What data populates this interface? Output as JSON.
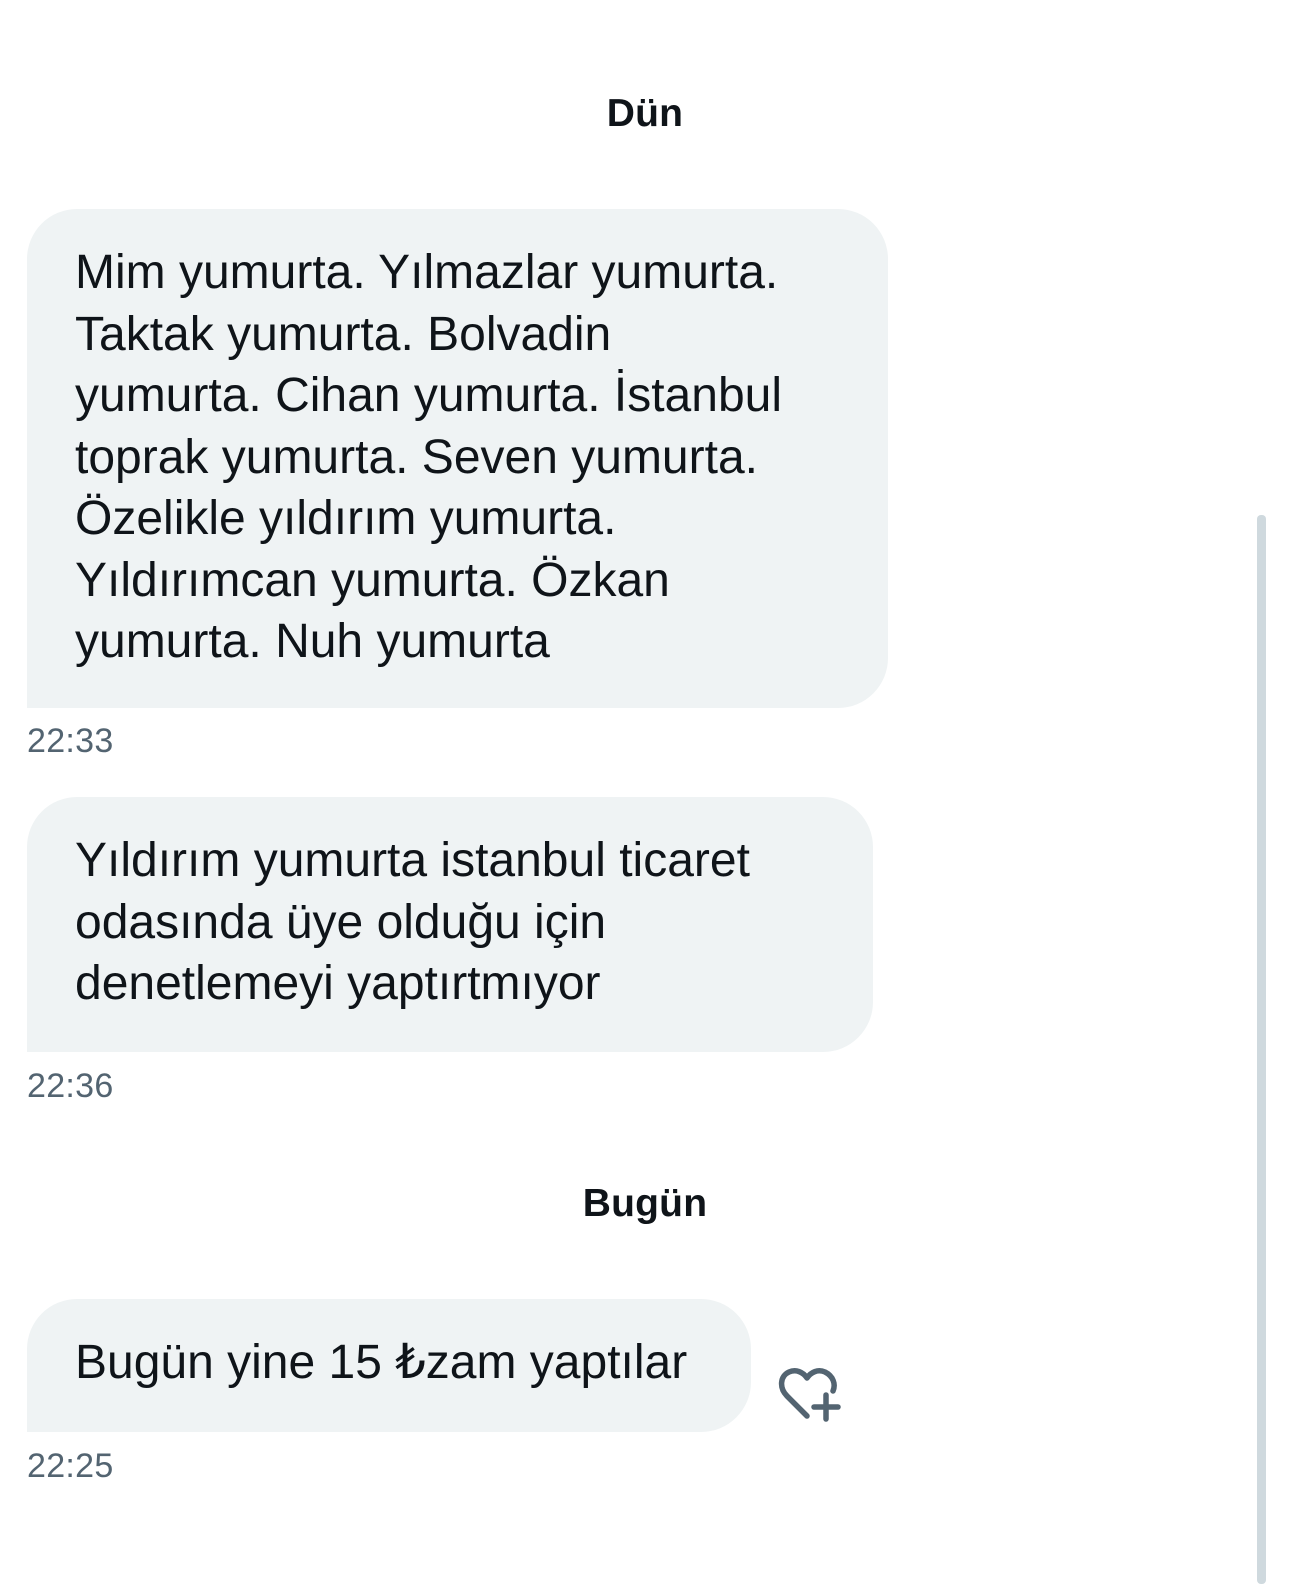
{
  "conversation": {
    "groups": [
      {
        "date_label": "Dün",
        "messages": [
          {
            "text": "Mim yumurta. Yılmazlar yumurta.\nTaktak yumurta. Bolvadin\nyumurta. Cihan yumurta. İstanbul\ntoprak yumurta. Seven yumurta.\nÖzelikle yıldırım yumurta.\nYıldırımcan yumurta. Özkan\nyumurta. Nuh yumurta",
            "time": "22:33"
          },
          {
            "text": "Yıldırım yumurta  istanbul ticaret\nodasında üye olduğu için\ndenetlemeyi yaptırtmıyor",
            "time": "22:36"
          }
        ]
      },
      {
        "date_label": "Bugün",
        "messages": [
          {
            "text": "Bugün yine 15 ₺zam yaptılar",
            "time": "22:25",
            "reaction_icon": "heart-plus-icon"
          }
        ]
      }
    ]
  },
  "colors": {
    "bubble_background": "#eff3f4",
    "text_primary": "#0f1419",
    "text_secondary": "#536471",
    "scrollbar": "#cfd9de"
  }
}
